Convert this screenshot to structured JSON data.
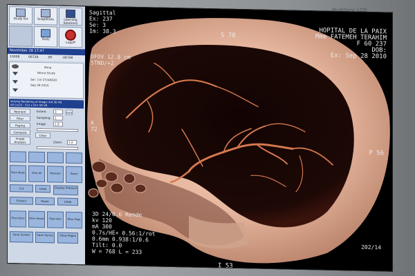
{
  "monitor": {
    "brand": "MultiSync LCD"
  },
  "toolbar": {
    "study_label": "Study list",
    "snap_label": "SnapShots",
    "learn_label": "Learning Solutions",
    "tools_label": "Tools",
    "power_label": "Logoff"
  },
  "study_info": {
    "dateline": "November 28 17:47",
    "series_num": "13008",
    "series_id": "06728",
    "series_label": "3D",
    "series_value": "06748",
    "name_line": "Mme",
    "desc1": "Neuro Study",
    "desc2": "Ser: 13/ CT/ANGIO",
    "desc3": "Sep 28 2010",
    "description_bar": "Volume Rendering of Image: 4/4 3D 4D",
    "description_bar2": "AX 0.625 - 512 x 512 3D VR"
  },
  "controls": {
    "reorient": "Reorient",
    "clear": "Clear",
    "filter_cropping": "Filter Cropping",
    "paging": "Paging",
    "compute": "Compute",
    "image_analysis": "Image Analysis",
    "mm": "mm",
    "extent_label": "Extent",
    "sampling_label": "Sampling",
    "image_label": "Image",
    "zoom_label": "Zoom",
    "zoom_value": "1.0",
    "image_value": "1.0",
    "extent_value": "3",
    "sampling_value": "1",
    "mark_mode": "Mark Mode",
    "view_all": "View All",
    "measure": "Measure",
    "display_protocol": "Display Protocol",
    "cut": "Cut",
    "undo": "Undo",
    "extract": "Extract",
    "reset": "Reset",
    "filter_bone": "Filter Bone",
    "filter_vessel": "Filter Vessel",
    "filter_skin": "Filter Skin",
    "filter_page": "Filter Page",
    "save_screen": "Save Screen",
    "save_series": "Save Series",
    "show_pages": "Show Pages"
  },
  "viewer": {
    "orientation_label": "Sagittal",
    "ex": "Ex: 237",
    "se": "Se: 3",
    "im": "Im: 38.3",
    "fdov": "DFOV 12.8 cm",
    "stnd": "STND/+2",
    "hospital": "HOPITAL DE LA PAIX",
    "patient": "Mme FATEMEH TERAHIM",
    "age_sex": "F 60 237",
    "dob": "DOB:",
    "exam_date": "Ex: Sep 28 2010",
    "marker_top": "S 70",
    "marker_right": "P 56",
    "marker_left_a": "A",
    "marker_left_num": "72",
    "marker_bottom": "I 53",
    "render_line": "3D 24/0.6 Rende",
    "kv": "kv 120",
    "ma": "mA 300",
    "rot": "0.7s/HE+ 0.56:1/rot",
    "mm_line": "0.6mm 0.938:1/0.6",
    "tilt": "Tilt: 0.0",
    "wl": "W = 768 L = 233",
    "page": "202/14"
  }
}
